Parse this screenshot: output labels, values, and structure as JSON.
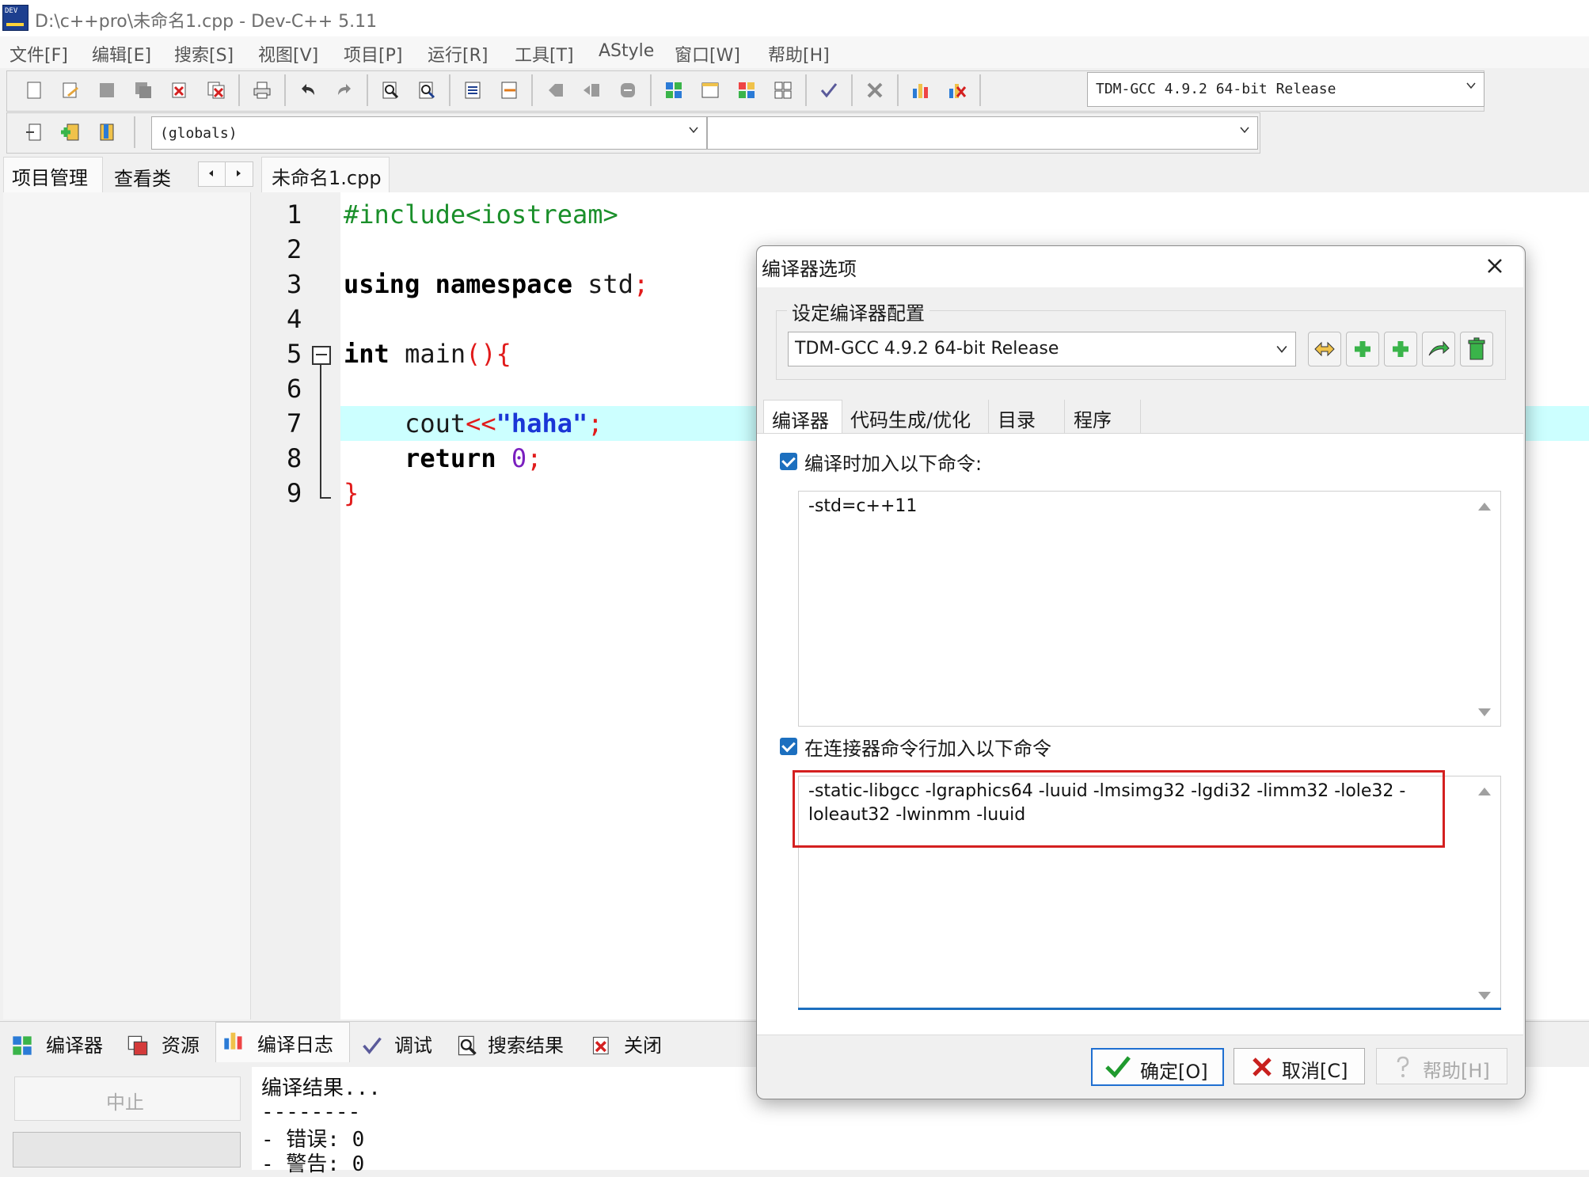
{
  "window": {
    "title": "D:\\c++pro\\未命名1.cpp - Dev-C++ 5.11"
  },
  "menu": [
    "文件[F]",
    "编辑[E]",
    "搜索[S]",
    "视图[V]",
    "项目[P]",
    "运行[R]",
    "工具[T]",
    "AStyle",
    "窗口[W]",
    "帮助[H]"
  ],
  "toolbar": {
    "compiler_combo": "TDM-GCC 4.9.2 64-bit Release",
    "scope_combo": "(globals)",
    "symbol_combo": ""
  },
  "side_tabs": {
    "project": "项目管理",
    "classes": "查看类"
  },
  "editor": {
    "tab": "未命名1.cpp",
    "line_numbers": [
      "1",
      "2",
      "3",
      "4",
      "5",
      "6",
      "7",
      "8",
      "9"
    ]
  },
  "bottom": {
    "tabs": [
      "编译器",
      "资源",
      "编译日志",
      "调试",
      "搜索结果",
      "关闭"
    ],
    "stop_button": "中止",
    "log": [
      "编译结果...",
      "--------",
      "- 错误: 0",
      "- 警告: 0"
    ]
  },
  "dialog": {
    "title": "编译器选项",
    "group_label": "设定编译器配置",
    "compiler_set": "TDM-GCC 4.9.2 64-bit Release",
    "tabs": [
      "编译器",
      "代码生成/优化",
      "目录",
      "程序"
    ],
    "compile_check_label": "编译时加入以下命令:",
    "compile_commands": "-std=c++11",
    "linker_check_label": "在连接器命令行加入以下命令",
    "linker_commands": "-static-libgcc -lgraphics64 -luuid -lmsimg32 -lgdi32 -limm32 -lole32 -loleaut32 -lwinmm -luuid",
    "ok_button": "确定[O]",
    "cancel_button": "取消[C]",
    "help_button": "帮助[H]"
  },
  "colors": {
    "current_line_highlight": "#ccffff",
    "red_highlight_box": "#d42020",
    "checkbox_blue": "#1c6fbf"
  }
}
